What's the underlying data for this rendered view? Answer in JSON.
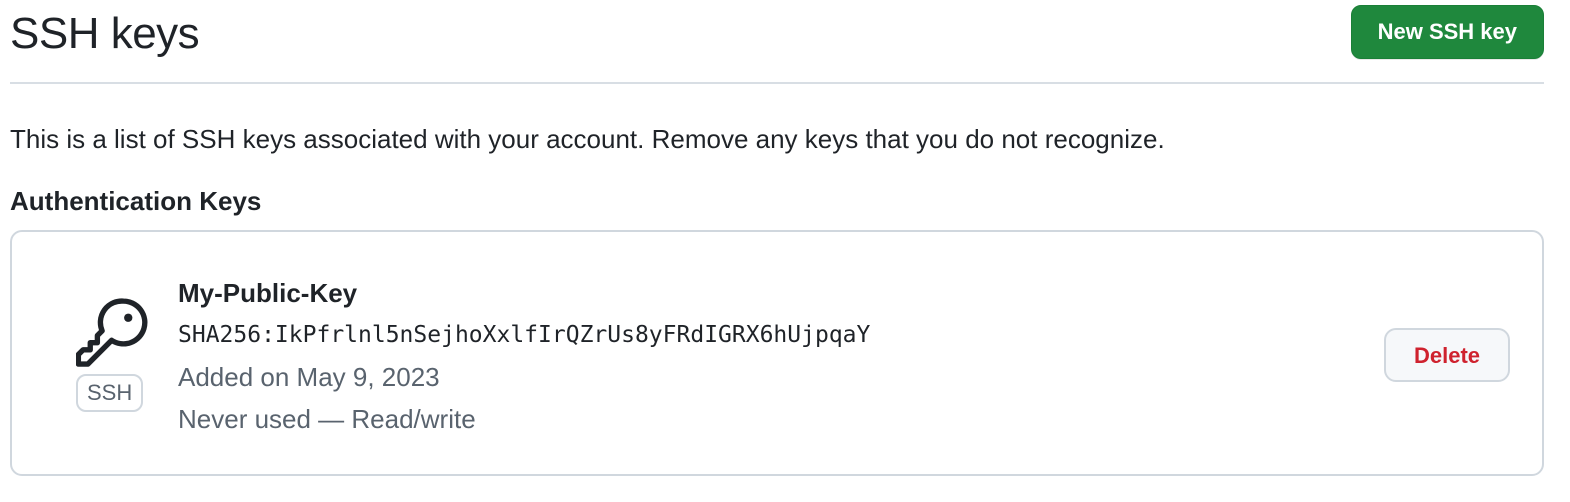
{
  "header": {
    "title": "SSH keys",
    "new_key_label": "New SSH key"
  },
  "description": "This is a list of SSH keys associated with your account. Remove any keys that you do not recognize.",
  "section_heading": "Authentication Keys",
  "keys": [
    {
      "icon": "key-icon",
      "type_badge": "SSH",
      "title": "My-Public-Key",
      "fingerprint": "SHA256:IkPfrlnl5nSejhoXxlfIrQZrUs8yFRdIGRX6hUjpqaY",
      "added": "Added on May 9, 2023",
      "usage": "Never used — Read/write",
      "delete_label": "Delete"
    }
  ],
  "colors": {
    "primary_button": "#1f883d",
    "danger_text": "#cf222e",
    "muted_text": "#59636e",
    "border": "#d0d7de"
  }
}
